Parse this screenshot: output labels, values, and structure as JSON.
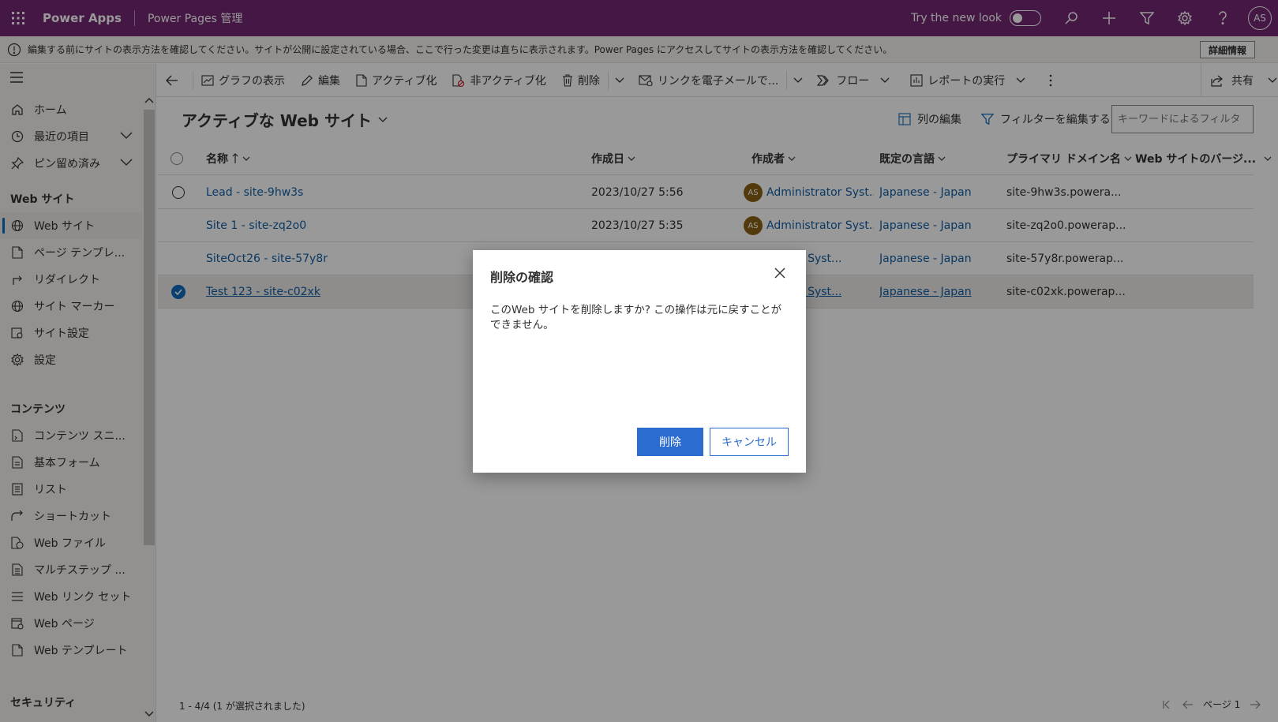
{
  "topbar": {
    "app_name": "Power Apps",
    "app_sub": "Power Pages 管理",
    "try_new_look": "Try the new look",
    "avatar": "AS"
  },
  "infobar": {
    "message": "編集する前にサイトの表示方法を確認してください。サイトが公開に設定されている場合、ここで行った変更は直ちに表示されます。Power Pages にアクセスしてサイトの表示方法を確認してください。",
    "button": "詳細情報"
  },
  "sidebar": {
    "items_top": [
      {
        "label": "ホーム",
        "icon": "home-icon"
      },
      {
        "label": "最近の項目",
        "icon": "clock-icon"
      },
      {
        "label": "ピン留め済み",
        "icon": "pin-icon"
      }
    ],
    "section_web": "Web サイト",
    "items_web": [
      {
        "label": "Web サイト",
        "icon": "globe-icon"
      },
      {
        "label": "ページ テンプレ...",
        "icon": "page-icon"
      },
      {
        "label": "リダイレクト",
        "icon": "redirect-icon"
      },
      {
        "label": "サイト マーカー",
        "icon": "globe-icon"
      },
      {
        "label": "サイト設定",
        "icon": "settings-page-icon"
      },
      {
        "label": "設定",
        "icon": "gear-icon"
      }
    ],
    "section_content": "コンテンツ",
    "items_content": [
      {
        "label": "コンテンツ スニ...",
        "icon": "snippet-icon"
      },
      {
        "label": "基本フォーム",
        "icon": "form-icon"
      },
      {
        "label": "リスト",
        "icon": "list-icon"
      },
      {
        "label": "ショートカット",
        "icon": "shortcut-icon"
      },
      {
        "label": "Web ファイル",
        "icon": "web-file-icon"
      },
      {
        "label": "マルチステップ ...",
        "icon": "multistep-icon"
      },
      {
        "label": "Web リンク セット",
        "icon": "lines-icon"
      },
      {
        "label": "Web ページ",
        "icon": "web-page-icon"
      },
      {
        "label": "Web テンプレート",
        "icon": "template-icon"
      }
    ],
    "section_security": "セキュリティ"
  },
  "commandbar": {
    "show_chart": "グラフの表示",
    "edit": "編集",
    "activate": "アクティブ化",
    "deactivate": "非アクティブ化",
    "delete": "削除",
    "email_link": "リンクを電子メールで...",
    "flow": "フロー",
    "run_report": "レポートの実行",
    "share": "共有"
  },
  "view": {
    "title": "アクティブな Web サイト",
    "edit_columns": "列の編集",
    "edit_filters": "フィルターを編集する",
    "keyword_placeholder": "キーワードによるフィルタ"
  },
  "grid": {
    "columns": [
      "名称",
      "作成日",
      "作成者",
      "既定の言語",
      "プライマリ ドメイン名",
      "Web サイトのバージ..."
    ],
    "rows": [
      {
        "name": "Lead - site-9hw3s",
        "created": "2023/10/27 5:56",
        "owner_initials": "AS",
        "owner": "Administrator Syst...",
        "language": "Japanese - Japan",
        "domain": "site-9hw3s.powera..."
      },
      {
        "name": "Site 1 - site-zq2o0",
        "created": "2023/10/27 5:35",
        "owner_initials": "AS",
        "owner": "Administrator Syst...",
        "language": "Japanese - Japan",
        "domain": "site-zq2o0.powerap..."
      },
      {
        "name": "SiteOct26 - site-57y8r",
        "created": "",
        "owner_initials": "",
        "owner": "trator Syst...",
        "language": "Japanese - Japan",
        "domain": "site-57y8r.powerap..."
      },
      {
        "name": "Test 123 - site-c02xk",
        "created": "",
        "owner_initials": "",
        "owner": "trator Syst...",
        "language": "Japanese - Japan",
        "domain": "site-c02xk.powerap..."
      }
    ]
  },
  "footer": {
    "count": "1 - 4/4 (1 が選択されました)",
    "page": "ページ 1"
  },
  "dialog": {
    "title": "削除の確認",
    "body": "このWeb サイトを削除しますか? この操作は元に戻すことができません。",
    "confirm": "削除",
    "cancel": "キャンセル"
  },
  "colors": {
    "header": "#742774",
    "primary": "#2b6cd1",
    "link": "#115ea3"
  }
}
